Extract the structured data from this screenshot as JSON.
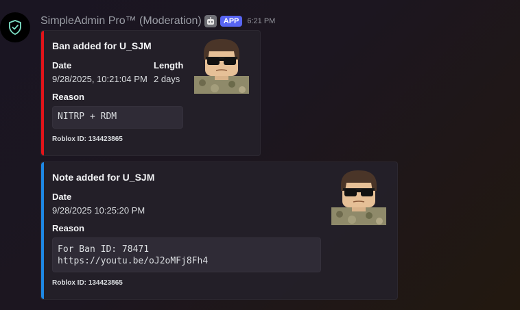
{
  "message": {
    "author": "SimpleAdmin Pro™ (Moderation)",
    "app_badge": "APP",
    "timestamp": "6:21 PM",
    "avatar_icon": "shield-check-icon",
    "tag_icon": "robot-icon"
  },
  "embeds": [
    {
      "accent_color": "#e3141a",
      "title": "Ban added for U_SJM",
      "fields": [
        {
          "name": "Date",
          "value": "9/28/2025, 10:21:04 PM"
        },
        {
          "name": "Length",
          "value": "2 days"
        },
        {
          "name": "Reason",
          "value": "NITRP + RDM"
        }
      ],
      "footer": "Roblox ID: 134423865",
      "thumbnail": "roblox-avatar-sunglasses"
    },
    {
      "accent_color": "#1e88e5",
      "title": "Note added for U_SJM",
      "fields": [
        {
          "name": "Date",
          "value": "9/28/2025 10:25:20 PM"
        },
        {
          "name": "Reason",
          "lines": [
            "For Ban ID: 78471",
            "https://youtu.be/oJ2oMFj8Fh4"
          ]
        }
      ],
      "footer": "Roblox ID: 134423865",
      "thumbnail": "roblox-avatar-sunglasses"
    }
  ]
}
